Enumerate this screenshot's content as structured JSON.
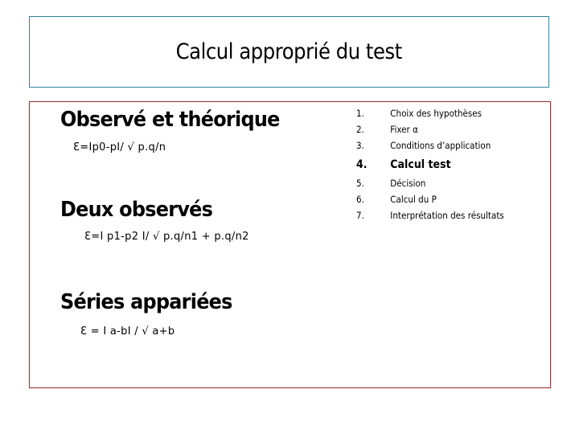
{
  "slide": {
    "title": "Calcul approprié du test",
    "colors": {
      "title_border": "#31849b",
      "content_border": "#943634"
    },
    "sections": [
      {
        "heading": "Observé et théorique",
        "formula": "Ɛ=Ip0-pI/ √  p.q/n"
      },
      {
        "heading": "Deux observés",
        "formula": "Ɛ=I p1-p2 I/ √  p.q/n1 + p.q/n2"
      },
      {
        "heading": "Séries appariées",
        "formula": "Ɛ =  I a-bI /  √  a+b"
      }
    ],
    "steps": [
      {
        "num": "1.",
        "label": "Choix des hypothèses"
      },
      {
        "num": "2.",
        "label": "Fixer α"
      },
      {
        "num": "3.",
        "label": "Conditions d’application"
      },
      {
        "num": "4.",
        "label": "Calcul test",
        "highlight": true
      },
      {
        "num": "5.",
        "label": "Décision"
      },
      {
        "num": "6.",
        "label": "Calcul du P"
      },
      {
        "num": "7.",
        "label": "Interprétation des résultats"
      }
    ]
  }
}
